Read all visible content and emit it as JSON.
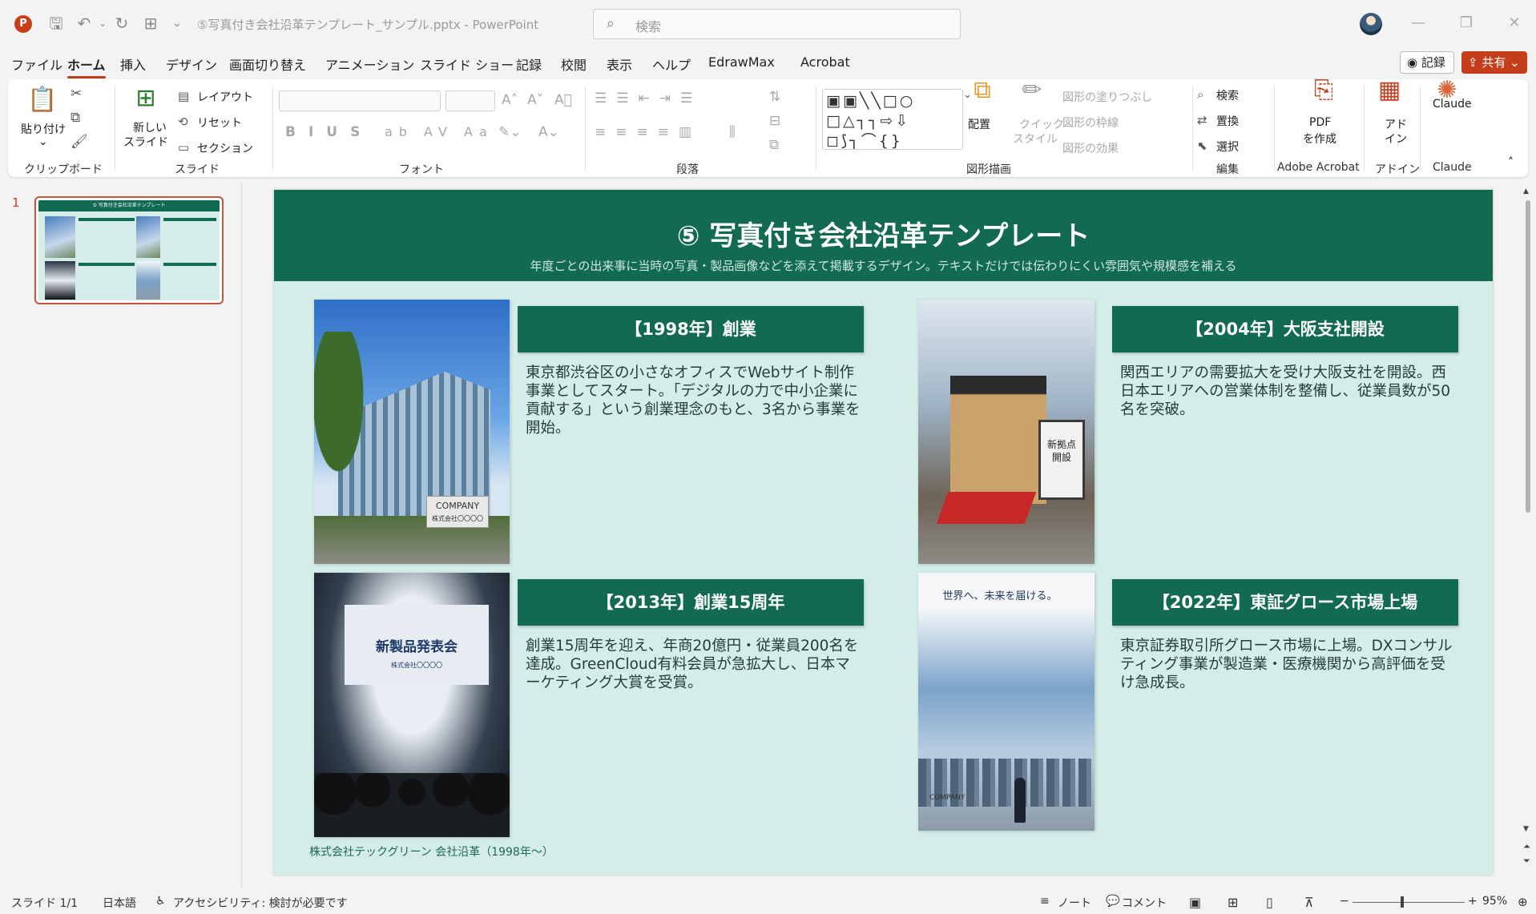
{
  "app": {
    "file_title": "⑤写真付き会社沿革テンプレート_サンプル.pptx  -  PowerPoint",
    "search_placeholder": "検索",
    "logo_letter": "P"
  },
  "tabs": [
    "ファイル",
    "ホーム",
    "挿入",
    "デザイン",
    "画面切り替え",
    "アニメーション",
    "スライド ショー",
    "記録",
    "校閲",
    "表示",
    "ヘルプ",
    "EdrawMax",
    "Acrobat"
  ],
  "active_tab": "ホーム",
  "header_buttons": {
    "record": "記録",
    "share": "共有"
  },
  "ribbon": {
    "clipboard": {
      "paste": "貼り付け",
      "label": "クリップボード"
    },
    "slides": {
      "new_slide_line1": "新しい",
      "new_slide_line2": "スライド",
      "layout": "レイアウト",
      "reset": "リセット",
      "section": "セクション",
      "label": "スライド"
    },
    "font": {
      "label": "フォント"
    },
    "paragraph": {
      "label": "段落"
    },
    "drawing": {
      "arrange": "配置",
      "quick_style_line1": "クイック",
      "quick_style_line2": "スタイル",
      "fill": "図形の塗りつぶし",
      "outline": "図形の枠線",
      "effects": "図形の効果",
      "label": "図形描画"
    },
    "editing": {
      "find": "検索",
      "replace": "置換",
      "select": "選択",
      "label": "編集"
    },
    "acrobat": {
      "pdf_line1": "PDF",
      "pdf_line2": "を作成",
      "label": "Adobe Acrobat"
    },
    "addins": {
      "line1": "アド",
      "line2": "イン",
      "label": "アドイン"
    },
    "claude": {
      "button": "Claude",
      "label": "Claude"
    }
  },
  "thumbnail": {
    "number": "1"
  },
  "slide": {
    "title": "⑤ 写真付き会社沿革テンプレート",
    "subtitle": "年度ごとの出来事に当時の写真・製品画像などを添えて掲載するデザイン。テキストだけでは伝わりにくい雰囲気や規模感を補える",
    "events": [
      {
        "heading": "【1998年】創業",
        "body": "東京都渋谷区の小さなオフィスでWebサイト制作事業としてスタート。「デジタルの力で中小企業に貢献する」という創業理念のもと、3名から事業を開始。",
        "photo_sign_line1": "COMPANY",
        "photo_sign_line2": "株式会社〇〇〇〇"
      },
      {
        "heading": "【2004年】大阪支社開設",
        "body": "関西エリアの需要拡大を受け大阪支社を開設。西日本エリアへの営業体制を整備し、従業員数が50名を突破。",
        "photo_sign_line1": "新拠点",
        "photo_sign_line2": "開設"
      },
      {
        "heading": "【2013年】創業15周年",
        "body": "創業15周年を迎え、年商20億円・従業員200名を達成。GreenCloud有料会員が急拡大し、日本マーケティング大賞を受賞。",
        "photo_sign_line1": "新製品発表会",
        "photo_sign_line2": "株式会社〇〇〇〇"
      },
      {
        "heading": "【2022年】東証グロース市場上場",
        "body": "東京証券取引所グロース市場に上場。DXコンサルティング事業が製造業・医療機関から高評価を受け急成長。",
        "photo_sign_line1": "世界へ、未来を届ける。",
        "photo_sign_line2": "COMPANY"
      }
    ],
    "footer": "株式会社テックグリーン 会社沿革（1998年〜）"
  },
  "status": {
    "slide": "スライド 1/1",
    "language": "日本語",
    "accessibility": "アクセシビリティ: 検討が必要です",
    "notes": "ノート",
    "comments": "コメント",
    "zoom": "95%"
  },
  "colors": {
    "accent": "#c43e1c",
    "slide_green": "#126b51",
    "slide_bg": "#d4ede8"
  },
  "icons": [
    "save-icon",
    "undo-icon",
    "redo-icon",
    "present-icon",
    "search-icon",
    "minimize-icon",
    "restore-icon",
    "close-icon",
    "cut-icon",
    "copy-icon",
    "format-painter-icon",
    "fit-slide-icon"
  ]
}
